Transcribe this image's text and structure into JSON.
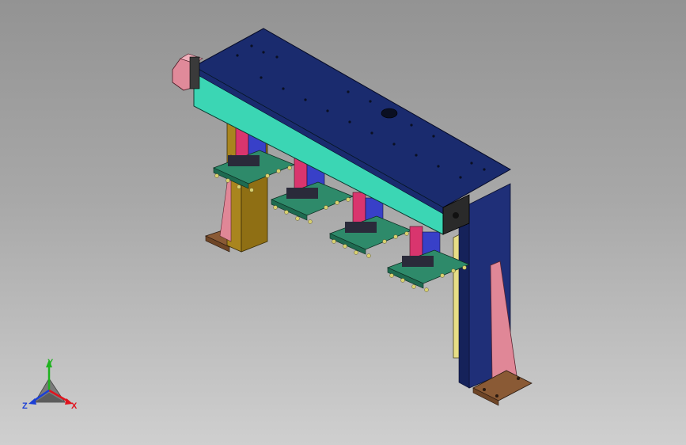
{
  "view": {
    "name": "isometric-cad-viewport"
  },
  "triad": {
    "x_label": "X",
    "y_label": "Y",
    "z_label": "Z",
    "x_color": "#e0141e",
    "y_color": "#1fb21f",
    "z_color": "#1b3fd6"
  },
  "model": {
    "colors": {
      "beam_top": "#1a2b6e",
      "beam_front": "#3bd6b4",
      "beam_dark": "#15225a",
      "post_blue": "#1f2f78",
      "leg_mustard": "#a9851e",
      "leg_light": "#e7de86",
      "gusset_pink": "#e08797",
      "base_plate": "#8a5a35",
      "motor_pink": "#e08a9a",
      "gripper_green": "#2e8a6a",
      "slide_pink": "#d9356e",
      "slide_blue": "#3840c8",
      "bolt": "#d8d070"
    },
    "gripper_count": 4
  }
}
